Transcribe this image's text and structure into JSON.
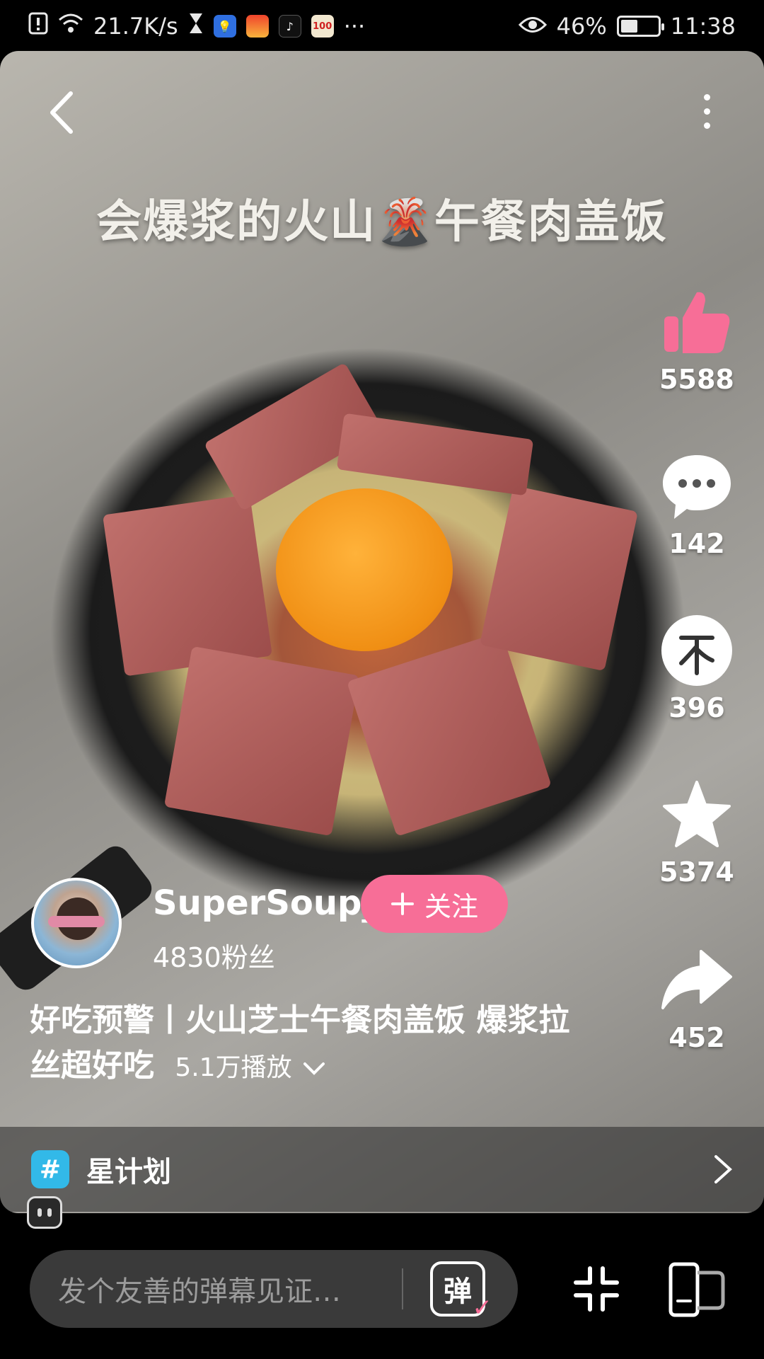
{
  "status_bar": {
    "network_speed": "21.7K/s",
    "icons": [
      "alert-icon",
      "wifi-icon",
      "hourglass-icon",
      "bulb-app-icon",
      "huawei-app-icon",
      "tiktok-app-icon",
      "100-app-icon",
      "more-dots-icon"
    ],
    "app_100_label": "100",
    "more": "···",
    "eye_icon": "eye-icon",
    "battery_percent": "46%",
    "battery_level": 0.46,
    "time": "11:38"
  },
  "video": {
    "caption": "会爆浆的火山🌋午餐肉盖饭",
    "back_icon": "chevron-left-icon",
    "more_icon": "vertical-dots-icon"
  },
  "actions": {
    "like": {
      "icon": "thumbs-up-icon",
      "count": "5588",
      "color": "#f76e97"
    },
    "comment": {
      "icon": "comment-bubble-icon",
      "count": "142"
    },
    "coin": {
      "icon": "coin-icon",
      "count": "396"
    },
    "favorite": {
      "icon": "star-icon",
      "count": "5374"
    },
    "share": {
      "icon": "share-arrow-icon",
      "count": "452"
    }
  },
  "author": {
    "name": "SuperSoup_",
    "fans": "4830粉丝",
    "follow_label": "关注",
    "follow_icon": "plus-icon"
  },
  "description": {
    "title": "好吃预警丨火山芝士午餐肉盖饭 爆浆拉丝超好吃",
    "plays": "5.1万播放"
  },
  "star_plan": {
    "label": "星计划",
    "hash": "#"
  },
  "bottom_bar": {
    "danmaku_placeholder": "发个友善的弹幕见证…",
    "danmaku_button": "弹"
  },
  "colors": {
    "accent_pink": "#f76e97",
    "hashtag_blue": "#32b9e8"
  }
}
